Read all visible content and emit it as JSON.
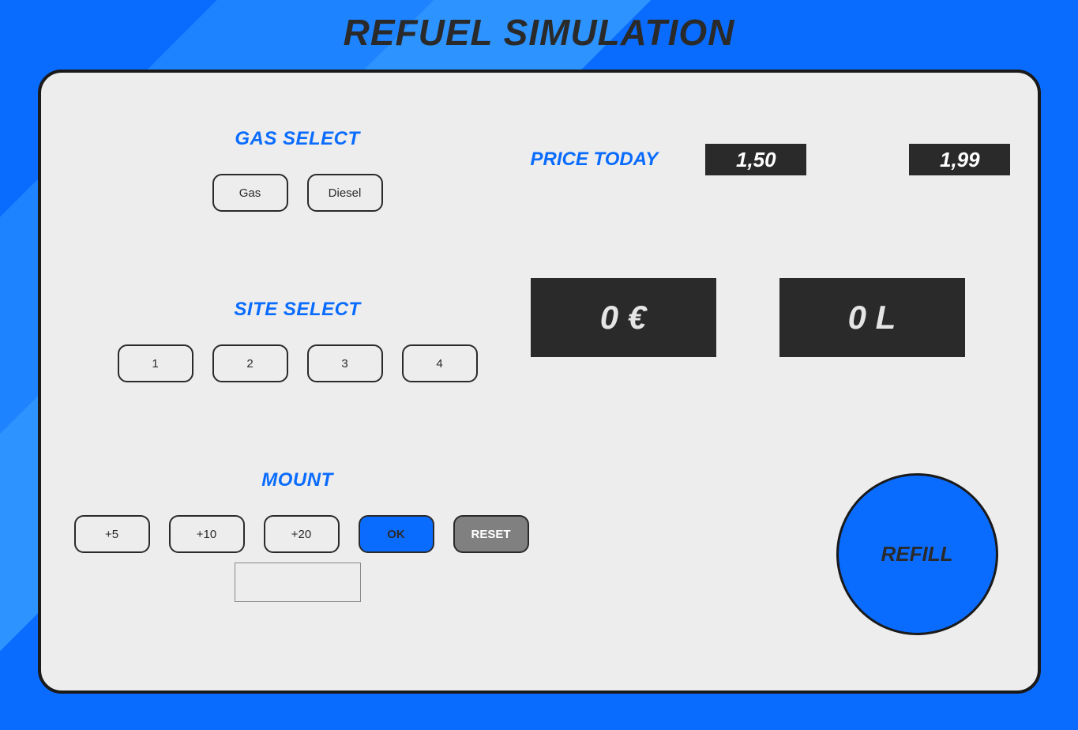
{
  "title": "REFUEL SIMULATION",
  "gasSelect": {
    "heading": "GAS SELECT",
    "options": [
      "Gas",
      "Diesel"
    ]
  },
  "siteSelect": {
    "heading": "SITE SELECT",
    "options": [
      "1",
      "2",
      "3",
      "4"
    ]
  },
  "mount": {
    "heading": "MOUNT",
    "increments": [
      "+5",
      "+10",
      "+20"
    ],
    "okLabel": "OK",
    "resetLabel": "RESET",
    "inputValue": ""
  },
  "priceToday": {
    "label": "PRICE TODAY",
    "prices": [
      "1,50",
      "1,99"
    ]
  },
  "displays": {
    "cost": "0 €",
    "volume": "0 L"
  },
  "refill": {
    "label": "REFILL"
  }
}
